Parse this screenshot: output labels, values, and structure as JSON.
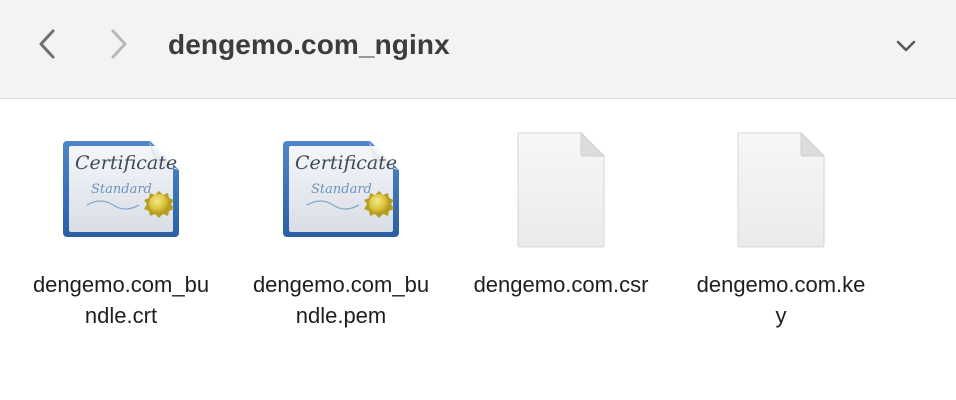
{
  "window": {
    "title": "dengemo.com_nginx"
  },
  "toolbar": {
    "back_icon": "chevron-left-icon",
    "forward_icon": "chevron-right-icon",
    "menu_icon": "chevron-down-icon"
  },
  "files": [
    {
      "name_line1": "dengemo.com_bu",
      "name_line2": "ndle.crt",
      "icon": "certificate-icon"
    },
    {
      "name_line1": "dengemo.com_bu",
      "name_line2": "ndle.pem",
      "icon": "certificate-icon"
    },
    {
      "name_line1": "dengemo.com.csr",
      "name_line2": "",
      "icon": "blank-document-icon"
    },
    {
      "name_line1": "dengemo.com.ke",
      "name_line2": "y",
      "icon": "blank-document-icon"
    }
  ]
}
